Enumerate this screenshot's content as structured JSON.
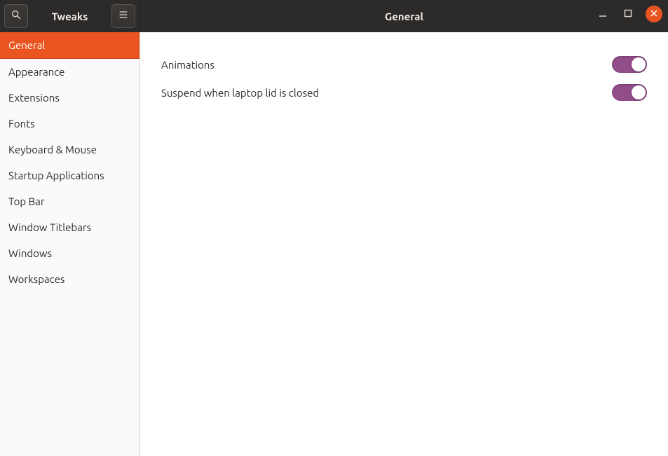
{
  "app_title": "Tweaks",
  "page_title": "General",
  "sidebar": {
    "items": [
      {
        "label": "General",
        "active": true
      },
      {
        "label": "Appearance",
        "active": false
      },
      {
        "label": "Extensions",
        "active": false
      },
      {
        "label": "Fonts",
        "active": false
      },
      {
        "label": "Keyboard & Mouse",
        "active": false
      },
      {
        "label": "Startup Applications",
        "active": false
      },
      {
        "label": "Top Bar",
        "active": false
      },
      {
        "label": "Window Titlebars",
        "active": false
      },
      {
        "label": "Windows",
        "active": false
      },
      {
        "label": "Workspaces",
        "active": false
      }
    ]
  },
  "settings": [
    {
      "label": "Animations",
      "value": true
    },
    {
      "label": "Suspend when laptop lid is closed",
      "value": true
    }
  ],
  "colors": {
    "accent": "#e95420",
    "toggle_on": "#924d8b",
    "titlebar": "#2d2a2a"
  }
}
